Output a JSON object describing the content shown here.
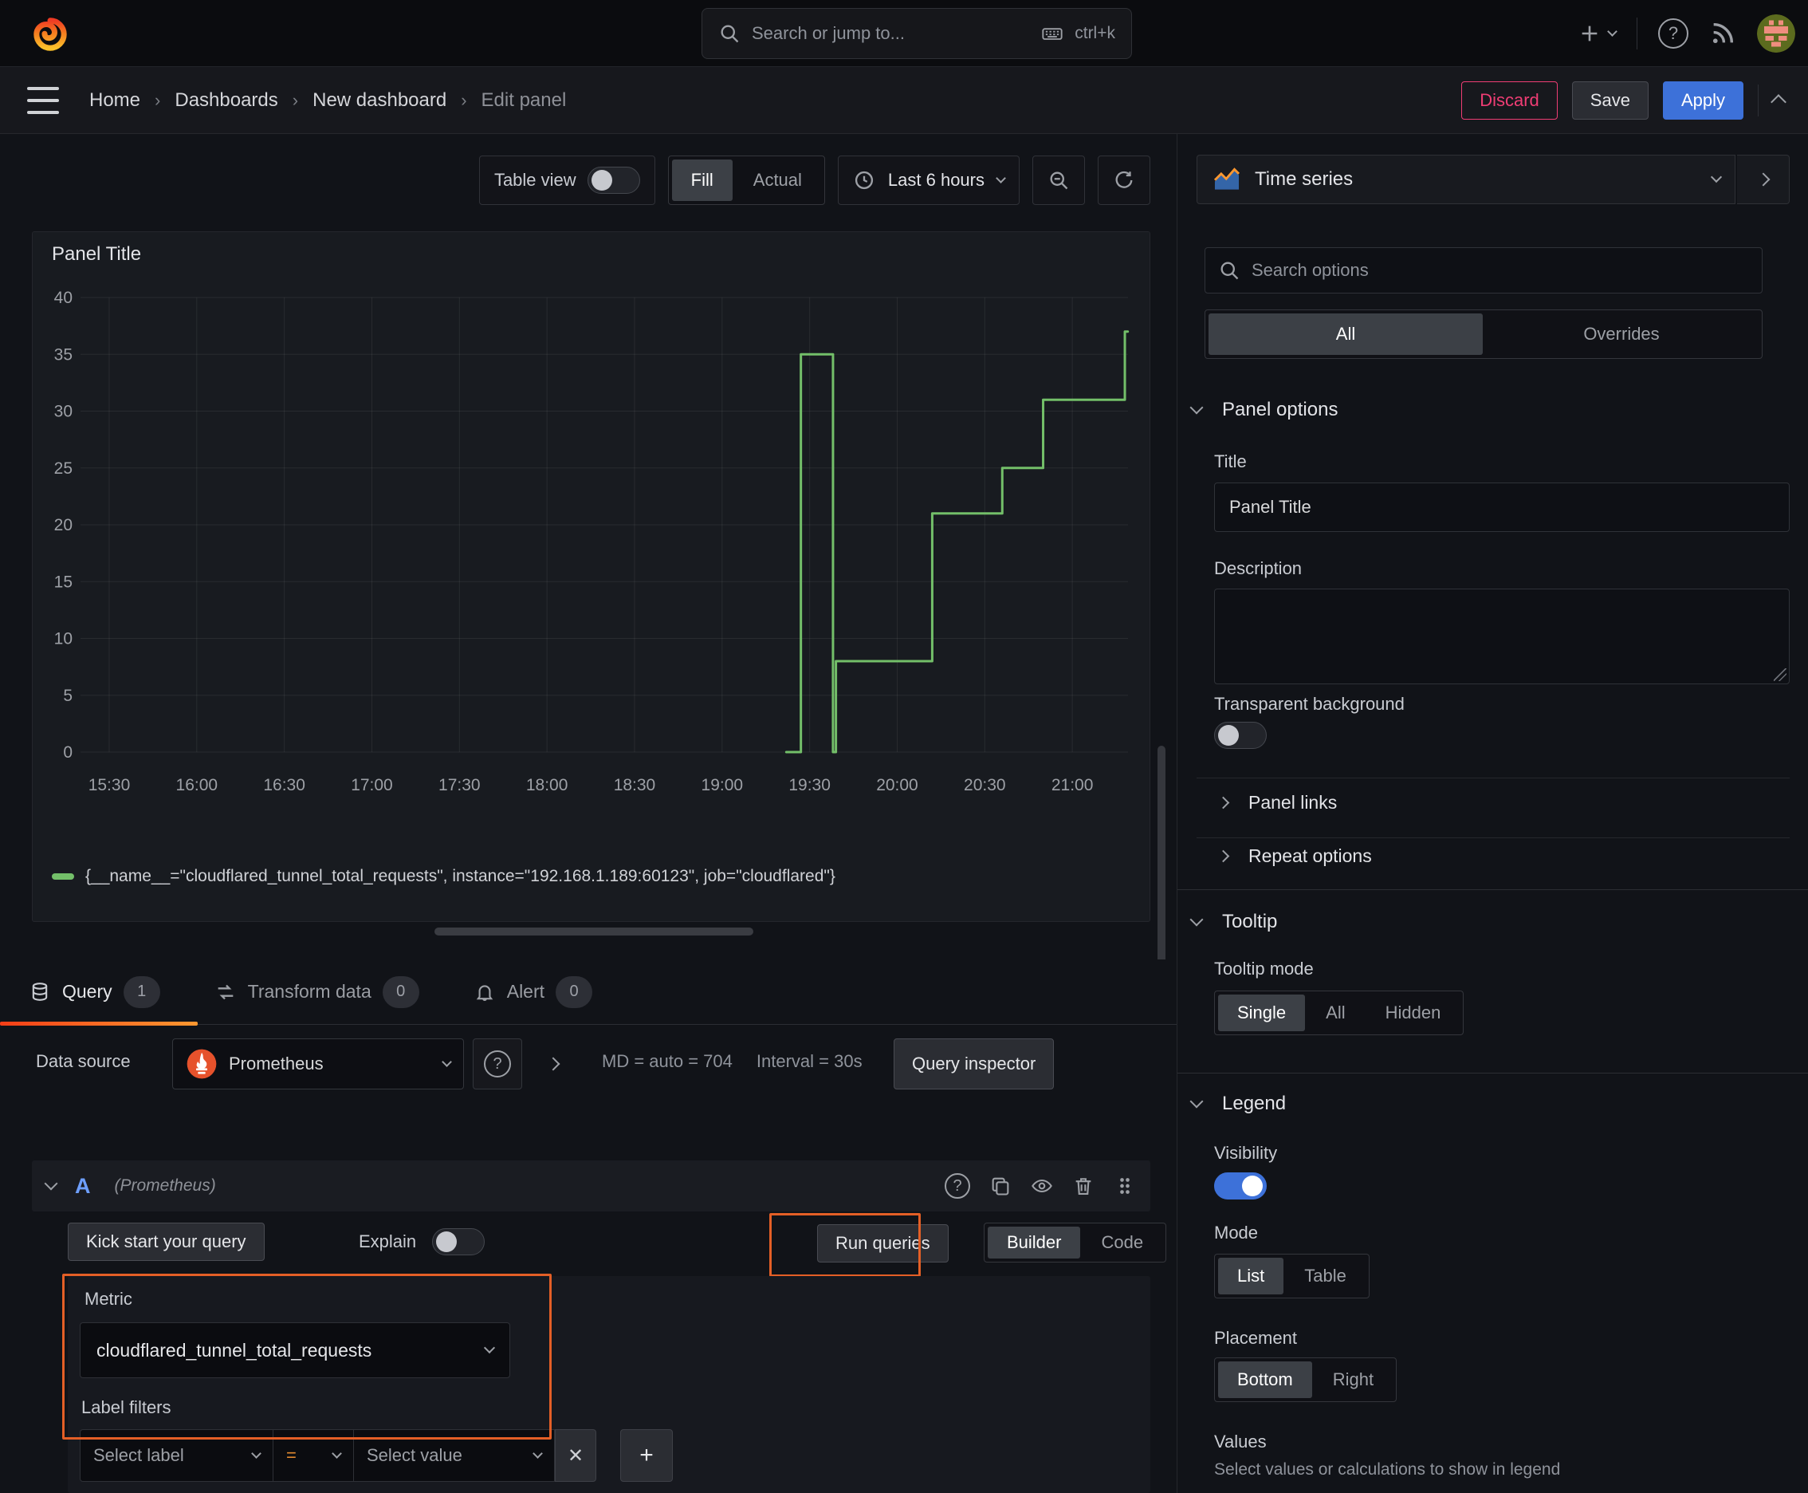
{
  "colors": {
    "accent_blue": "#3d71d9",
    "toggle_on": "#3d71d9",
    "annotation_orange": "#e45f26",
    "discard_pink": "#ef3d74",
    "series_green": "#73bf69",
    "tab_gradient_start": "#f53e17",
    "tab_gradient_end": "#ff9830",
    "ref_blue": "#6e9fff",
    "prometheus_orange": "#e6522c",
    "equals_orange": "#e0882e"
  },
  "topnav": {
    "search_placeholder": "Search or jump to...",
    "shortcut": "ctrl+k"
  },
  "breadcrumb": {
    "items": [
      "Home",
      "Dashboards",
      "New dashboard",
      "Edit panel"
    ]
  },
  "header_actions": {
    "discard": "Discard",
    "save": "Save",
    "apply": "Apply"
  },
  "toolbar": {
    "table_view": "Table view",
    "fill": "Fill",
    "actual": "Actual",
    "time_range": "Last 6 hours"
  },
  "panel": {
    "title": "Panel Title",
    "legend": "{__name__=\"cloudflared_tunnel_total_requests\", instance=\"192.168.1.189:60123\", job=\"cloudflared\"}"
  },
  "chart_data": {
    "type": "line",
    "line_style": "step-after",
    "title": "Panel Title",
    "grid": true,
    "ylim": [
      0,
      40
    ],
    "y_ticks": [
      0,
      5,
      10,
      15,
      20,
      25,
      30,
      35,
      40
    ],
    "x_domain": [
      "15:22",
      "21:19"
    ],
    "x_ticks": [
      "15:30",
      "16:00",
      "16:30",
      "17:00",
      "17:30",
      "18:00",
      "18:30",
      "19:00",
      "19:30",
      "20:00",
      "20:30",
      "21:00"
    ],
    "series": [
      {
        "name": "{__name__=\"cloudflared_tunnel_total_requests\", instance=\"192.168.1.189:60123\", job=\"cloudflared\"}",
        "color": "#73bf69",
        "steps": [
          [
            "19:22",
            0
          ],
          [
            "19:27",
            35
          ],
          [
            "19:38",
            0
          ],
          [
            "19:39",
            8
          ],
          [
            "20:12",
            21
          ],
          [
            "20:36",
            25
          ],
          [
            "20:50",
            31
          ],
          [
            "21:18",
            37
          ]
        ]
      }
    ]
  },
  "tabs": {
    "query": "Query",
    "query_count": "1",
    "transform": "Transform data",
    "transform_count": "0",
    "alert": "Alert",
    "alert_count": "0"
  },
  "datasource": {
    "label": "Data source",
    "name": "Prometheus",
    "md": "MD = auto = 704",
    "interval": "Interval = 30s",
    "inspector": "Query inspector"
  },
  "query": {
    "ref": "A",
    "ds_hint": "(Prometheus)",
    "kick_start": "Kick start your query",
    "explain": "Explain",
    "run": "Run queries",
    "builder": "Builder",
    "code": "Code",
    "metric_label": "Metric",
    "metric_value": "cloudflared_tunnel_total_requests",
    "label_filters": "Label filters",
    "select_label": "Select label",
    "operator": "=",
    "select_value": "Select value"
  },
  "sidebar": {
    "viz": "Time series",
    "search_placeholder": "Search options",
    "tab_all": "All",
    "tab_overrides": "Overrides",
    "panel_options": {
      "heading": "Panel options",
      "title_label": "Title",
      "title_value": "Panel Title",
      "description_label": "Description",
      "transparent": "Transparent background"
    },
    "links": "Panel links",
    "repeat": "Repeat options",
    "tooltip": {
      "heading": "Tooltip",
      "mode_label": "Tooltip mode",
      "options": [
        "Single",
        "All",
        "Hidden"
      ]
    },
    "legend": {
      "heading": "Legend",
      "visibility": "Visibility",
      "mode_label": "Mode",
      "modes": [
        "List",
        "Table"
      ],
      "placement_label": "Placement",
      "placements": [
        "Bottom",
        "Right"
      ],
      "values_label": "Values",
      "values_hint": "Select values or calculations to show in legend"
    }
  }
}
